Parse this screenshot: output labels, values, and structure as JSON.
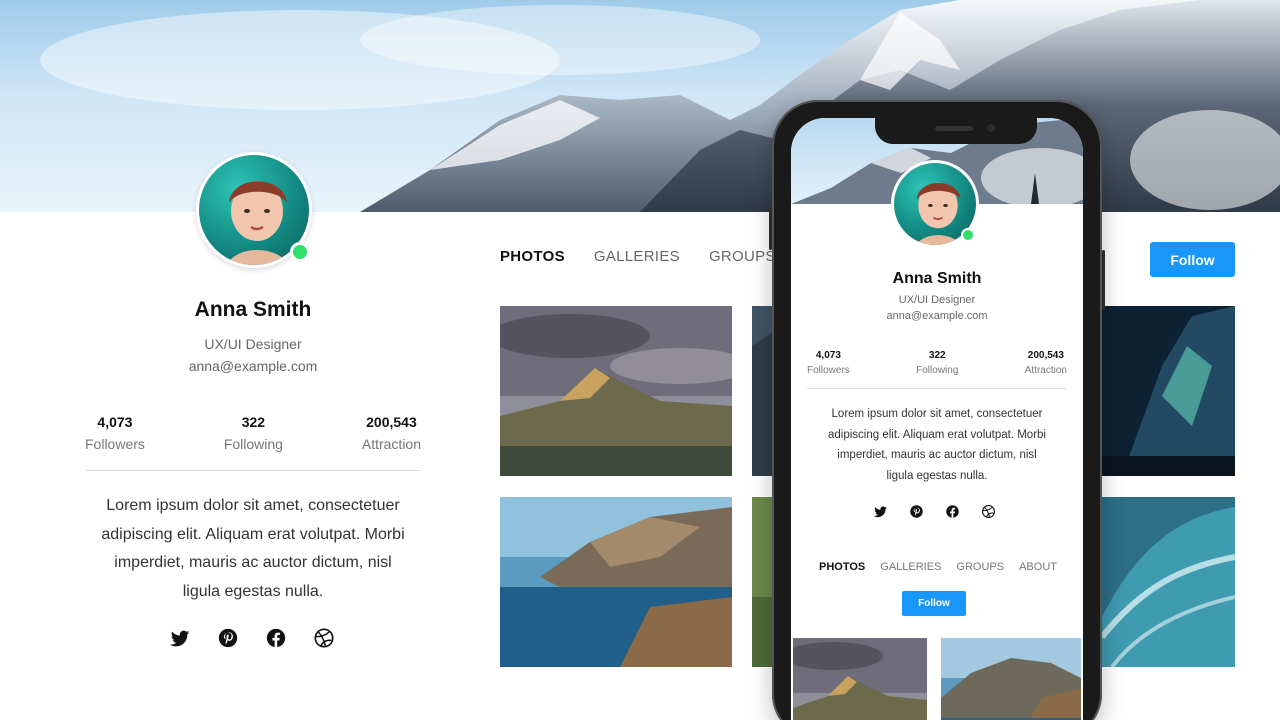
{
  "profile": {
    "name": "Anna Smith",
    "role": "UX/UI Designer",
    "email": "anna@example.com",
    "online": true,
    "stats": [
      {
        "value": "4,073",
        "label": "Followers"
      },
      {
        "value": "322",
        "label": "Following"
      },
      {
        "value": "200,543",
        "label": "Attraction"
      }
    ],
    "bio_lines": [
      "Lorem ipsum dolor sit amet, consectetuer",
      "adipiscing elit. Aliquam erat volutpat. Morbi",
      "imperdiet, mauris ac auctor dictum, nisl",
      "ligula egestas nulla."
    ],
    "social_icons": [
      "twitter-icon",
      "pinterest-icon",
      "facebook-icon",
      "dribbble-icon"
    ]
  },
  "tabs": [
    {
      "label": "PHOTOS",
      "active": true
    },
    {
      "label": "GALLERIES",
      "active": false
    },
    {
      "label": "GROUPS",
      "active": false
    },
    {
      "label": "ABOUT",
      "active": false
    }
  ],
  "follow_label": "Follow",
  "mobile": {
    "bio_lines": [
      "Lorem ipsum dolor sit amet, consectetuer",
      "adipiscing elit. Aliquam erat volutpat. Morbi",
      "imperdiet, mauris ac auctor dictum, nisl",
      "ligula egestas nulla."
    ]
  },
  "colors": {
    "accent": "#1896fb",
    "online": "#2ee06a"
  }
}
